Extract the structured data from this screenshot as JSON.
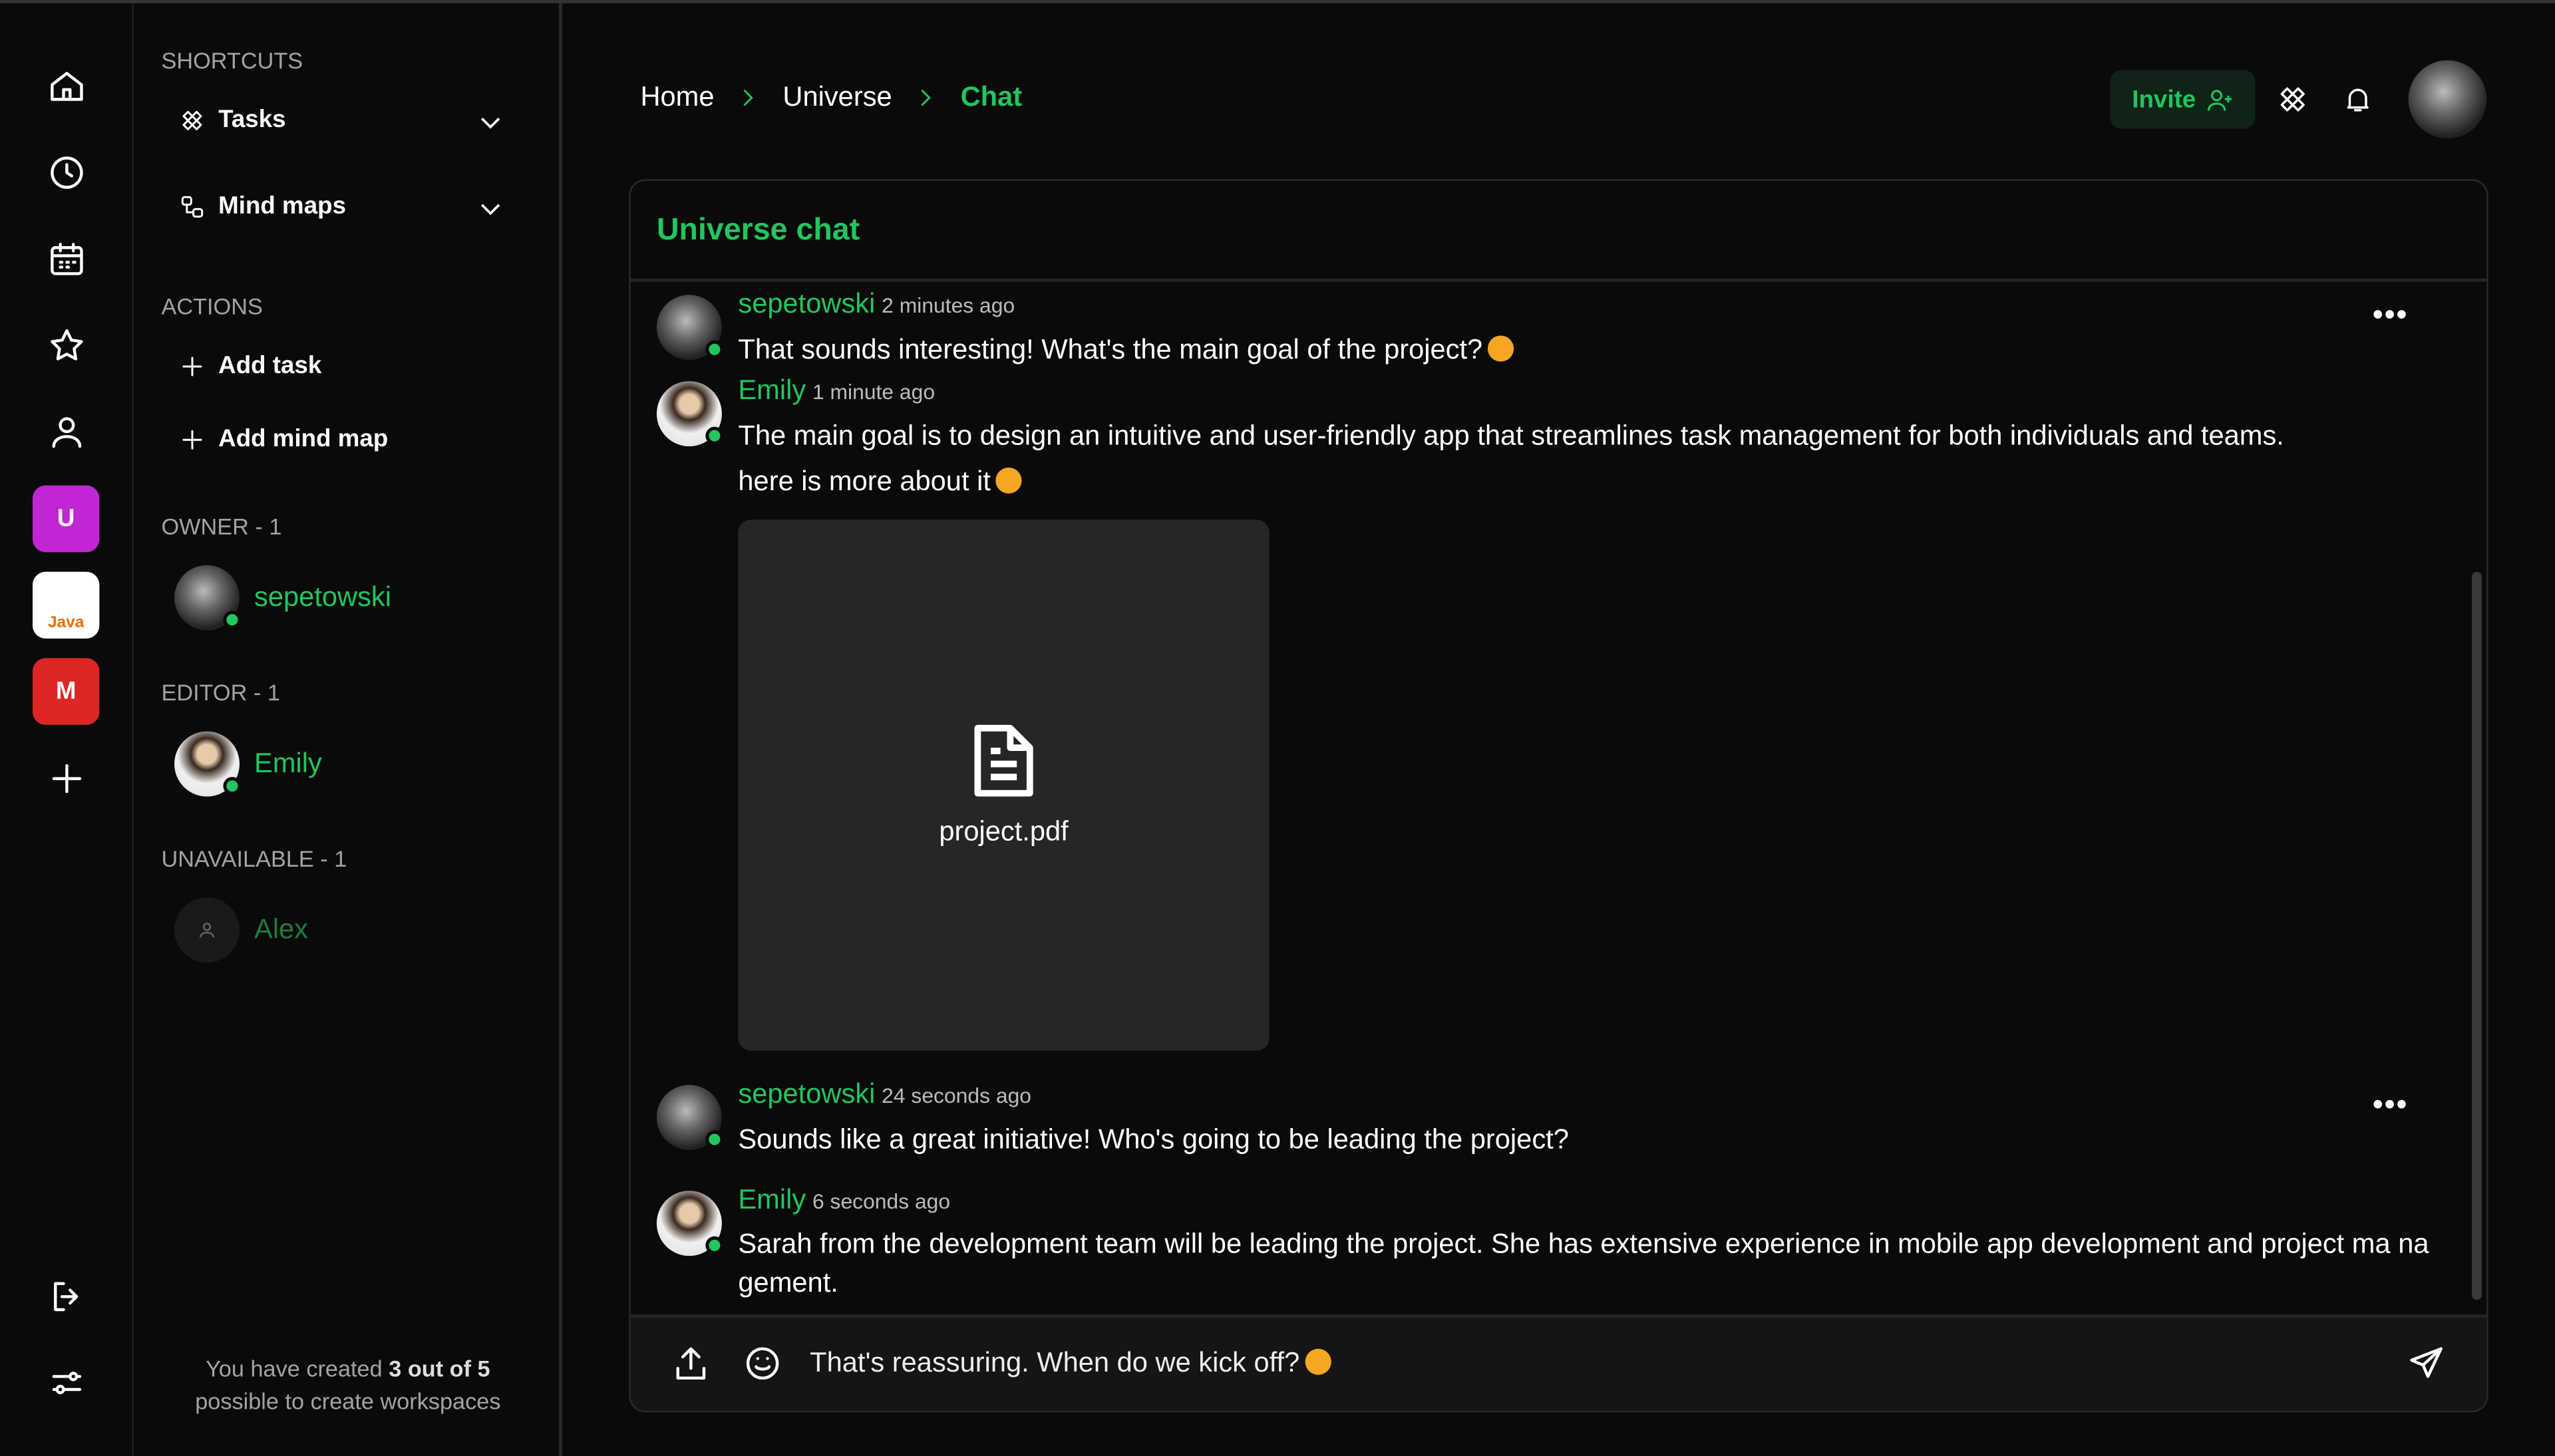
{
  "rail": {
    "items": [
      "home-icon",
      "clock-icon",
      "calendar-icon",
      "star-icon",
      "user-icon"
    ],
    "workspaces": [
      {
        "letter": "U",
        "color": "#c026d3"
      },
      {
        "letter": "Java",
        "color": "#ffffff"
      },
      {
        "letter": "M",
        "color": "#dc2626"
      }
    ],
    "bottom": [
      "logout-icon",
      "settings-sliders-icon"
    ]
  },
  "sidebar": {
    "shortcuts_label": "SHORTCUTS",
    "shortcuts": [
      "Tasks",
      "Mind maps"
    ],
    "actions_label": "ACTIONS",
    "actions": [
      "Add task",
      "Add mind map"
    ],
    "owner_label": "OWNER - 1",
    "owner": "sepetowski",
    "editor_label": "EDITOR - 1",
    "editor": "Emily",
    "unavailable_label": "UNAVAILABLE - 1",
    "unavailable": "Alex",
    "footer_pre": "You have created ",
    "footer_bold": "3 out of 5",
    "footer_post": "possible to create workspaces"
  },
  "header": {
    "breadcrumb": [
      "Home",
      "Universe",
      "Chat"
    ],
    "invite": "Invite"
  },
  "chat": {
    "title": "Universe chat",
    "messages": [
      {
        "author": "sepetowski",
        "time": "2 minutes ago",
        "text": "That sounds interesting! What's the main goal of the project?"
      },
      {
        "author": "Emily",
        "time": "1 minute ago",
        "text": "The main goal is to design an intuitive and user-friendly app that streamlines task management for both individuals and teams.",
        "text2": "here is more about it",
        "file": "project.pdf"
      },
      {
        "author": "sepetowski",
        "time": "24 seconds ago",
        "text": "Sounds like a great initiative! Who's going to be leading the project?"
      },
      {
        "author": "Emily",
        "time": "6 seconds ago",
        "text": "Sarah from the development team will be leading the project. She has extensive experience in mobile app development and project ma nagement."
      }
    ],
    "input_value": "That's reassuring. When do we kick off?"
  },
  "colors": {
    "accent": "#22c55e",
    "background": "#0a0a0a"
  }
}
